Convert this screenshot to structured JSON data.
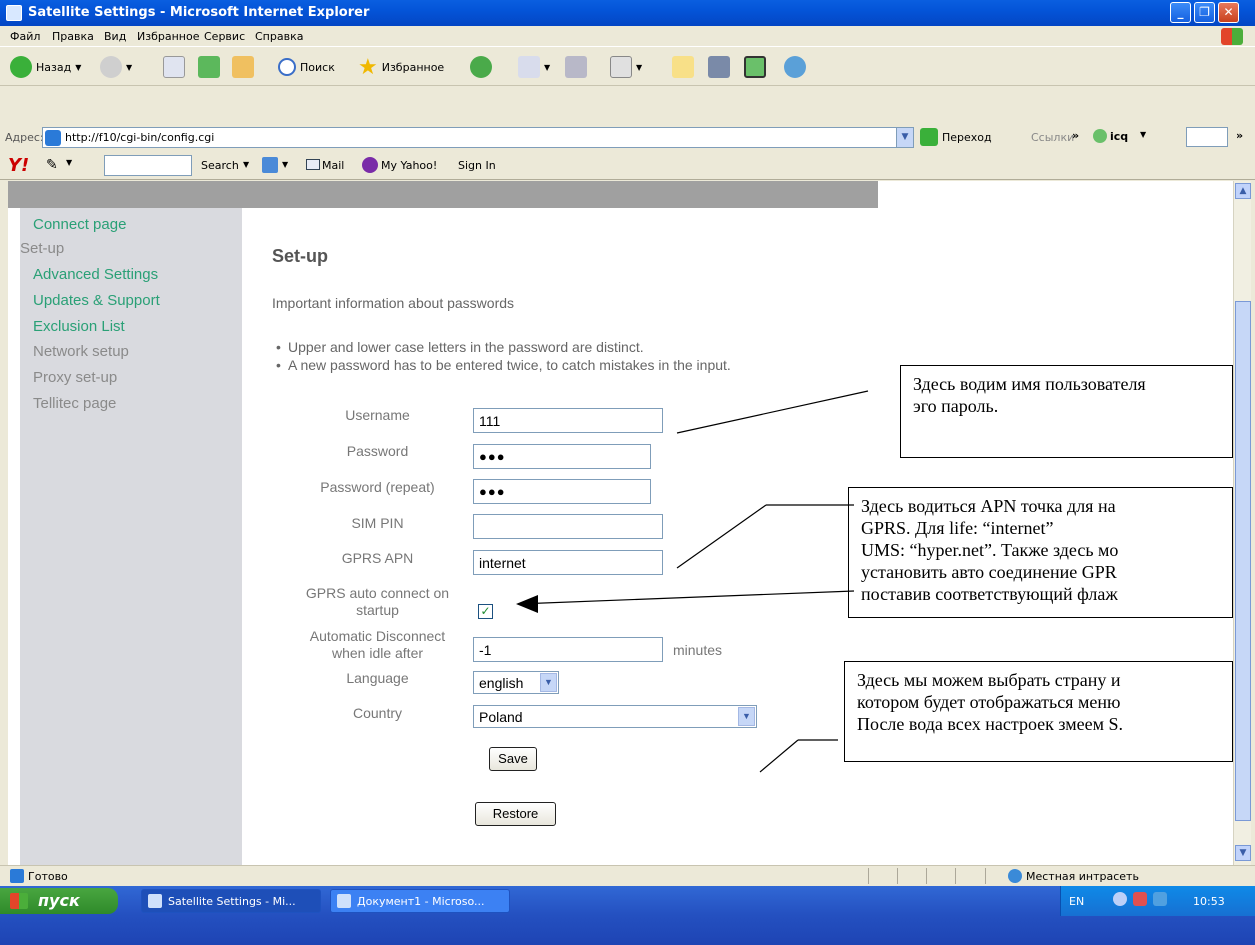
{
  "window": {
    "title": "Satellite Settings - Microsoft Internet Explorer"
  },
  "menu": [
    "Файл",
    "Правка",
    "Вид",
    "Избранное",
    "Сервис",
    "Справка"
  ],
  "toolbar": {
    "back": "Назад",
    "search": "Поиск",
    "favorites": "Избранное"
  },
  "address": {
    "label": "Адрес:",
    "url": "http://f10/cgi-bin/config.cgi",
    "go": "Переход",
    "links": "Ссылки",
    "icq": "icq"
  },
  "yahoo": {
    "search": "Search",
    "mail": "Mail",
    "my_yahoo": "My Yahoo!",
    "sign_in": "Sign In"
  },
  "nav": {
    "connect": "Connect page",
    "setup": "Set-up",
    "advanced": "Advanced Settings",
    "updates": "Updates & Support",
    "exclusion": "Exclusion List",
    "network": "Network setup",
    "proxy": "Proxy set-up",
    "tellitec": "Tellitec page"
  },
  "main": {
    "title": "Set-up",
    "info": "Important information about passwords",
    "bullet1": "Upper and lower case letters in the password are distinct.",
    "bullet2": "A new password has to be entered twice, to catch mistakes in the input."
  },
  "form": {
    "username_label": "Username",
    "username_value": "111",
    "password_label": "Password",
    "password_value": "●●●",
    "password_repeat_label": "Password (repeat)",
    "password_repeat_value": "●●●",
    "sim_pin_label": "SIM PIN",
    "sim_pin_value": "",
    "apn_label": "GPRS APN",
    "apn_value": "internet",
    "auto_connect_label_1": "GPRS auto connect on",
    "auto_connect_label_2": "startup",
    "auto_connect_checked": "✓",
    "disconnect_label_1": "Automatic Disconnect",
    "disconnect_label_2": "when idle after",
    "disconnect_value": "-1",
    "disconnect_unit": "minutes",
    "language_label": "Language",
    "language_value": "english",
    "country_label": "Country",
    "country_value": "Poland",
    "save": "Save",
    "restore": "Restore"
  },
  "callouts": {
    "c1_l1": "Здесь водим имя пользователя",
    "c1_l2": "эго пароль.",
    "c2_l1": "Здесь водиться APN точка для на",
    "c2_l2": "GPRS. Для life: “internet”",
    "c2_l3": "UMS: “hyper.net”. Также здесь мо",
    "c2_l4": "установить авто соединение GPR",
    "c2_l5": "поставив соответствующий флаж",
    "c3_l1": "Здесь мы можем выбрать страну и",
    "c3_l2": "котором будет отображаться меню",
    "c3_l3": "После вода всех настроек змеем S."
  },
  "status": {
    "text": "Готово",
    "zone": "Местная интрасеть"
  },
  "taskbar": {
    "start": "пуск",
    "task1": "Satellite Settings - Mi...",
    "task2": "Документ1 - Microso...",
    "lang": "EN",
    "time": "10:53"
  }
}
